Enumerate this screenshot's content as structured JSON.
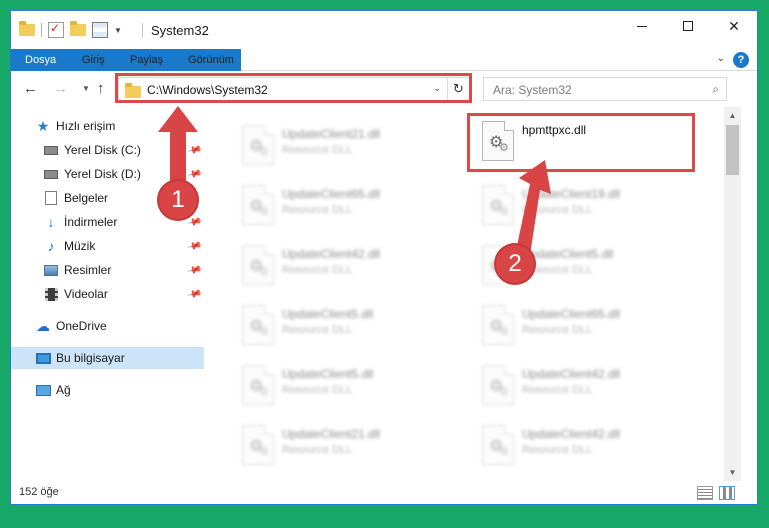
{
  "window": {
    "title": "System32",
    "controls": {
      "minimize": "—",
      "maximize": "□",
      "close": "✕"
    }
  },
  "ribbon": {
    "tabs": [
      "Dosya",
      "Giriş",
      "Paylaş",
      "Görünüm"
    ],
    "help": "?"
  },
  "navigation": {
    "address": "C:\\Windows\\System32",
    "search_placeholder": "Ara: System32"
  },
  "sidebar": {
    "items": [
      {
        "label": "Hızlı erişim",
        "icon": "star-icon"
      },
      {
        "label": "Yerel Disk (C:)",
        "icon": "drive-icon"
      },
      {
        "label": "Yerel Disk (D:)",
        "icon": "drive-icon"
      },
      {
        "label": "Belgeler",
        "icon": "documents-icon"
      },
      {
        "label": "İndirmeler",
        "icon": "download-icon"
      },
      {
        "label": "Müzik",
        "icon": "music-icon"
      },
      {
        "label": "Resimler",
        "icon": "pictures-icon"
      },
      {
        "label": "Videolar",
        "icon": "videos-icon"
      },
      {
        "label": "OneDrive",
        "icon": "cloud-icon"
      },
      {
        "label": "Bu bilgisayar",
        "icon": "computer-icon"
      },
      {
        "label": "Ağ",
        "icon": "network-icon"
      }
    ]
  },
  "files": {
    "highlighted": {
      "name": "hpmttpxc.dll"
    },
    "left_column": [
      {
        "name": "UpdateClient21.dll",
        "type": "Resource DLL"
      },
      {
        "name": "UpdateClient65.dll",
        "type": "Resource DLL"
      },
      {
        "name": "UpdateClient42.dll",
        "type": "Resource DLL"
      },
      {
        "name": "UpdateClient5.dll",
        "type": "Resource DLL"
      },
      {
        "name": "UpdateClient5.dll",
        "type": "Resource DLL"
      },
      {
        "name": "UpdateClient21.dll",
        "type": "Resource DLL"
      }
    ],
    "right_column": [
      {
        "name": "UpdateClient19.dll",
        "type": "Resource DLL"
      },
      {
        "name": "UpdateClient5.dll",
        "type": "Resource DLL"
      },
      {
        "name": "UpdateClient65.dll",
        "type": "Resource DLL"
      },
      {
        "name": "UpdateClient42.dll",
        "type": "Resource DLL"
      },
      {
        "name": "UpdateClient42.dll",
        "type": "Resource DLL"
      }
    ]
  },
  "status": {
    "item_count": "152 öğe"
  },
  "annotations": {
    "step1": "1",
    "step2": "2",
    "accent_color": "#d94545"
  }
}
